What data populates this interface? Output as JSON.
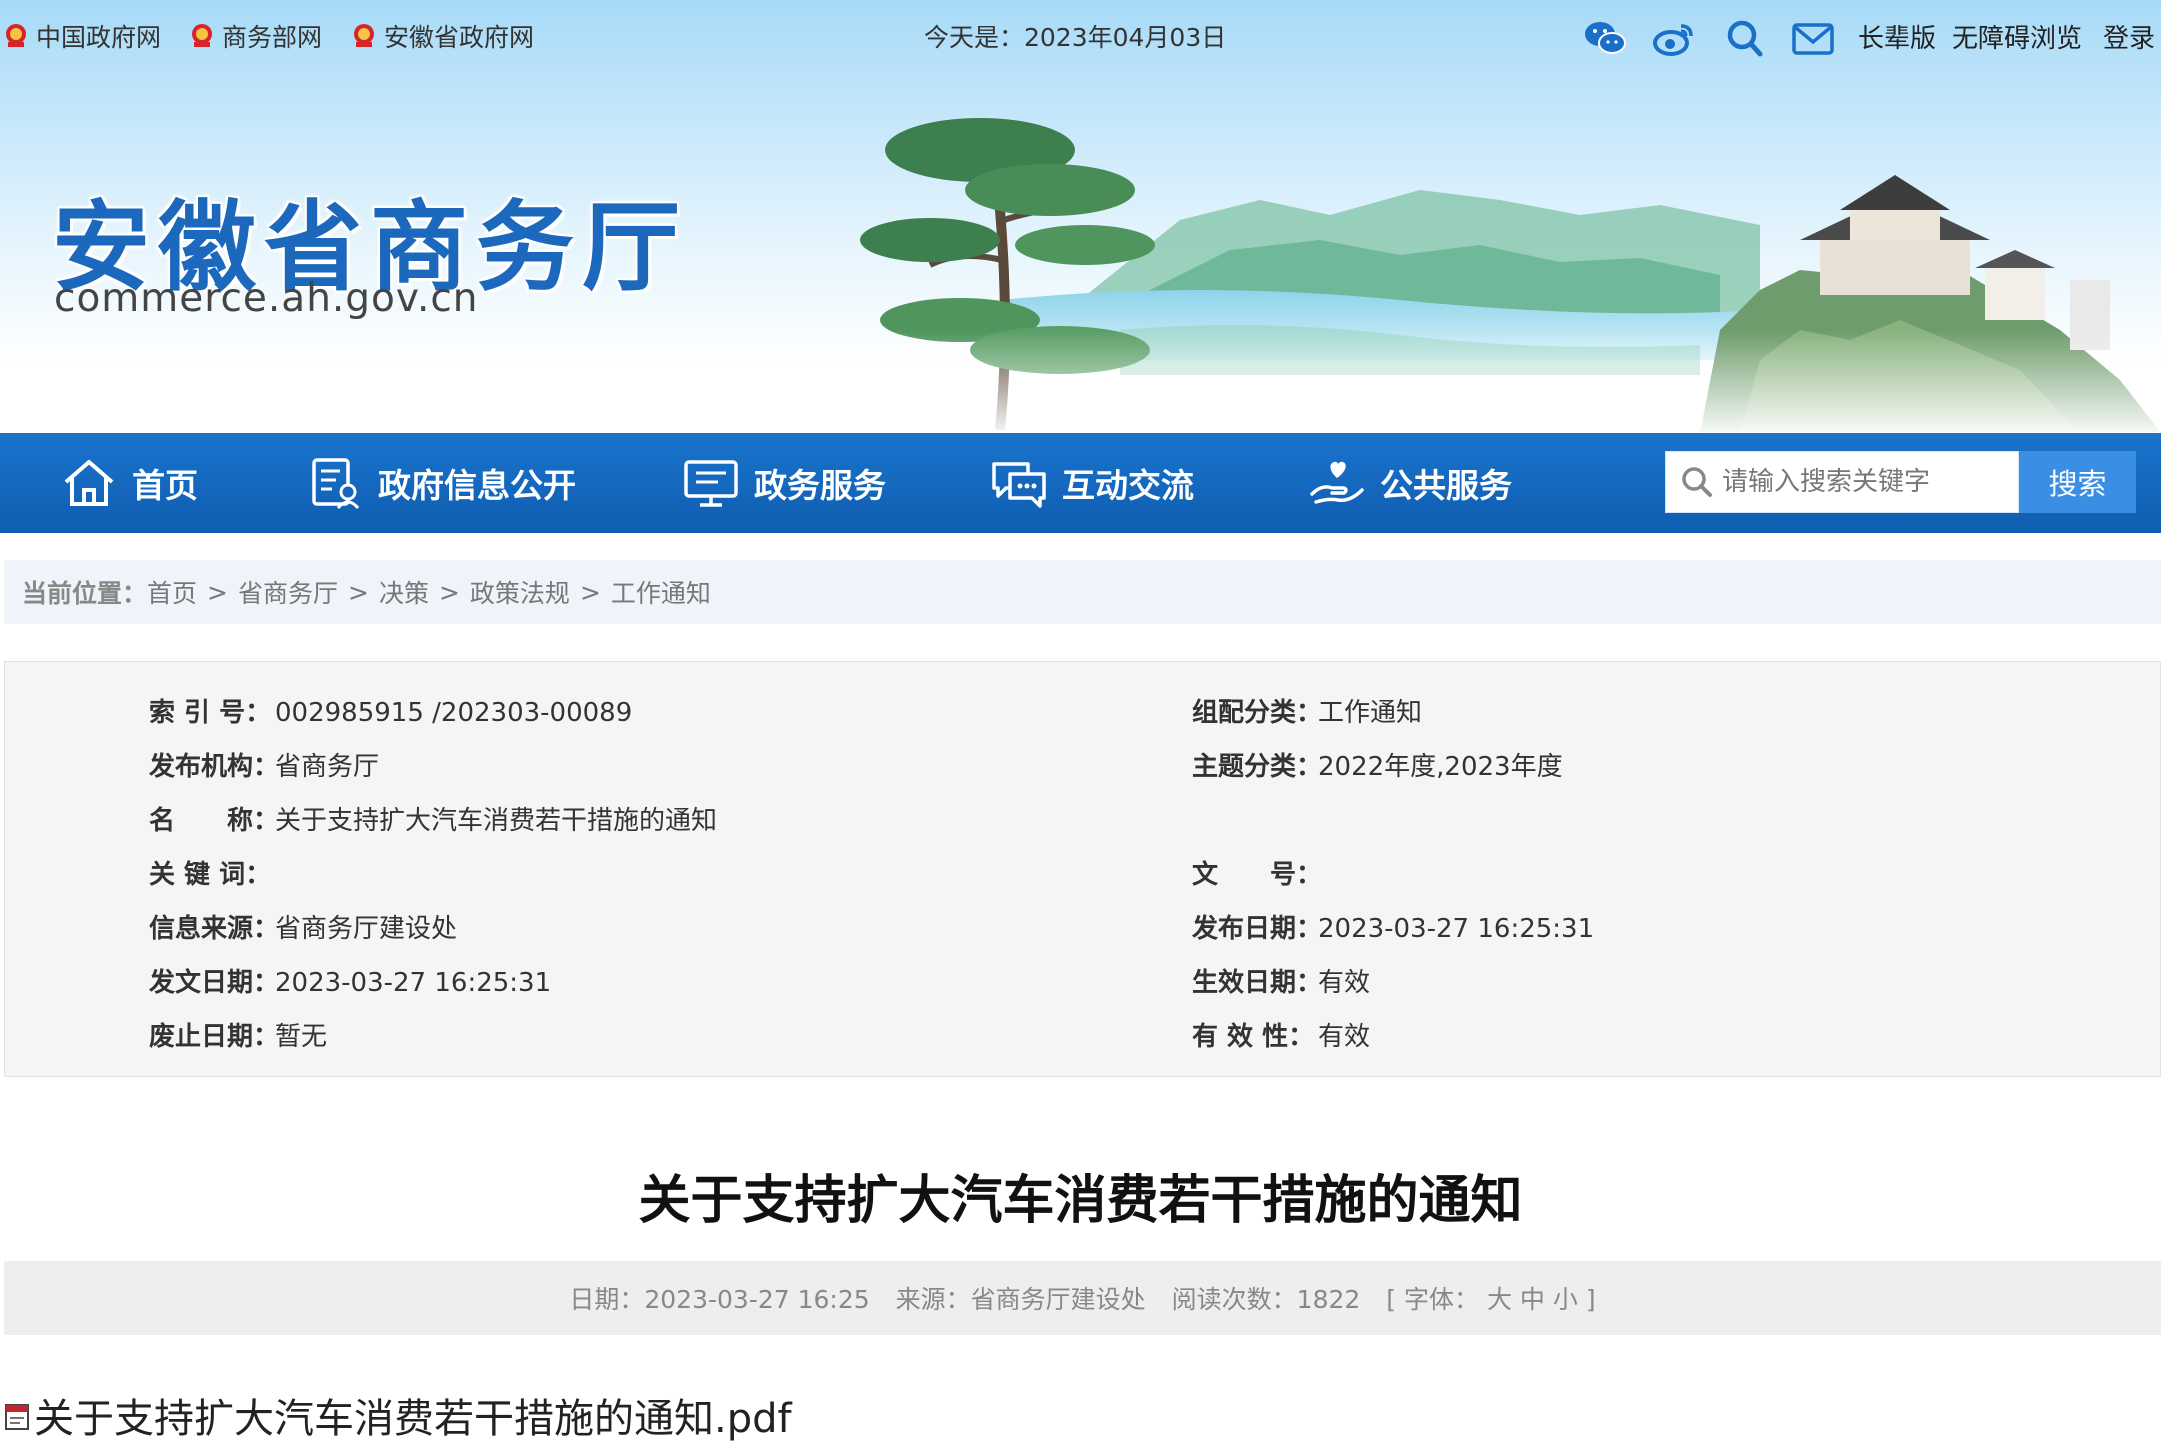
{
  "topbar": {
    "links": [
      "中国政府网",
      "商务部网",
      "安徽省政府网"
    ],
    "today": "今天是：2023年04月03日",
    "elder_mode": "长辈版",
    "accessible": "无障碍浏览",
    "login": "登录"
  },
  "site": {
    "title": "安徽省商务厅",
    "domain": "commerce.ah.gov.cn"
  },
  "nav": {
    "items": [
      "首页",
      "政府信息公开",
      "政务服务",
      "互动交流",
      "公共服务"
    ],
    "search_placeholder": "请输入搜索关键字",
    "search_button": "搜索"
  },
  "breadcrumb": {
    "label": "当前位置：",
    "items": [
      "首页",
      "省商务厅",
      "决策",
      "政策法规",
      "工作通知"
    ],
    "separator": ">"
  },
  "info": {
    "index_no_label": "索 引 号：",
    "index_no": "002985915 /202303-00089",
    "category_label": "组配分类：",
    "category": "工作通知",
    "publisher_label": "发布机构：",
    "publisher": "省商务厅",
    "topic_label": "主题分类：",
    "topic": "2022年度,2023年度",
    "name_label": "名　　称：",
    "name": "关于支持扩大汽车消费若干措施的通知",
    "keywords_label": "关 键 词：",
    "keywords": "",
    "doc_no_label": "文　　号：",
    "doc_no": "",
    "source_label": "信息来源：",
    "source": "省商务厅建设处",
    "publish_date_label": "发布日期：",
    "publish_date": "2023-03-27 16:25:31",
    "issue_date_label": "发文日期：",
    "issue_date": "2023-03-27 16:25:31",
    "effective_date_label": "生效日期：",
    "effective_date": "有效",
    "repeal_date_label": "废止日期：",
    "repeal_date": "暂无",
    "validity_label": "有 效 性：",
    "validity": "有效"
  },
  "article": {
    "title": "关于支持扩大汽车消费若干措施的通知",
    "date": "日期：2023-03-27 16:25",
    "source": "来源：省商务厅建设处",
    "views": "阅读次数：1822",
    "font_size_open": "[ 字体：",
    "font_large": "大",
    "font_medium": "中",
    "font_small": "小",
    "font_size_close": "]",
    "attachment": "关于支持扩大汽车消费若干措施的通知.pdf"
  },
  "colors": {
    "brand_blue": "#1b68bd",
    "nav_blue": "#1465bb",
    "search_button": "#3a8ee4"
  },
  "icons": [
    "emblem-icon",
    "wechat-icon",
    "weibo-icon",
    "search-icon",
    "mail-icon",
    "home-icon",
    "gov-info-icon",
    "monitor-icon",
    "chat-icon",
    "hand-heart-icon",
    "pdf-icon"
  ]
}
